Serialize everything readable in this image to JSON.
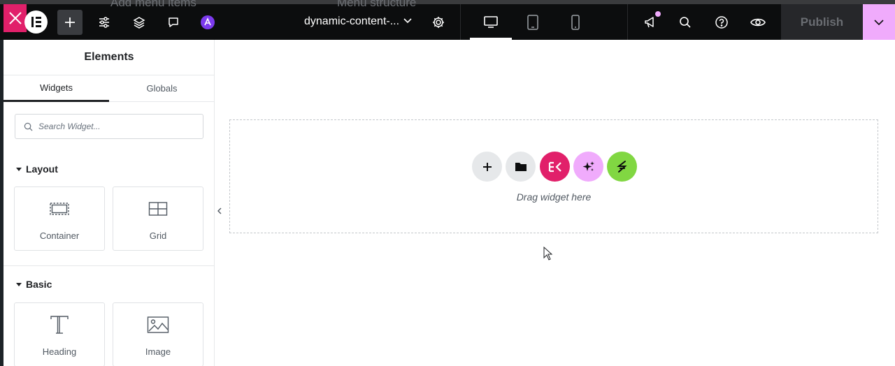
{
  "background_text": {
    "left": "Add menu items",
    "right": "Menu structure"
  },
  "topbar": {
    "doc_title": "dynamic-content-...",
    "publish_label": "Publish",
    "colors": {
      "close_bg": "#e1206a",
      "publish_more_bg": "#f0abfc",
      "ai_bg": "#7c3aed"
    }
  },
  "panel": {
    "title": "Elements",
    "tabs": [
      {
        "label": "Widgets",
        "active": true
      },
      {
        "label": "Globals",
        "active": false
      }
    ],
    "search_placeholder": "Search Widget...",
    "sections": [
      {
        "title": "Layout",
        "widgets": [
          {
            "label": "Container",
            "icon": "container-icon"
          },
          {
            "label": "Grid",
            "icon": "grid-icon"
          }
        ]
      },
      {
        "title": "Basic",
        "widgets": [
          {
            "label": "Heading",
            "icon": "heading-icon"
          },
          {
            "label": "Image",
            "icon": "image-icon"
          }
        ]
      }
    ]
  },
  "canvas": {
    "drop_text": "Drag widget here",
    "buttons": [
      {
        "name": "add-section",
        "bg": "#e6e8ea"
      },
      {
        "name": "template-library",
        "bg": "#e6e8ea"
      },
      {
        "name": "elementor-kit",
        "bg": "#e1206a"
      },
      {
        "name": "ai-assistant",
        "bg": "#f0abfc"
      },
      {
        "name": "layout-tool",
        "bg": "#81d742"
      }
    ]
  }
}
